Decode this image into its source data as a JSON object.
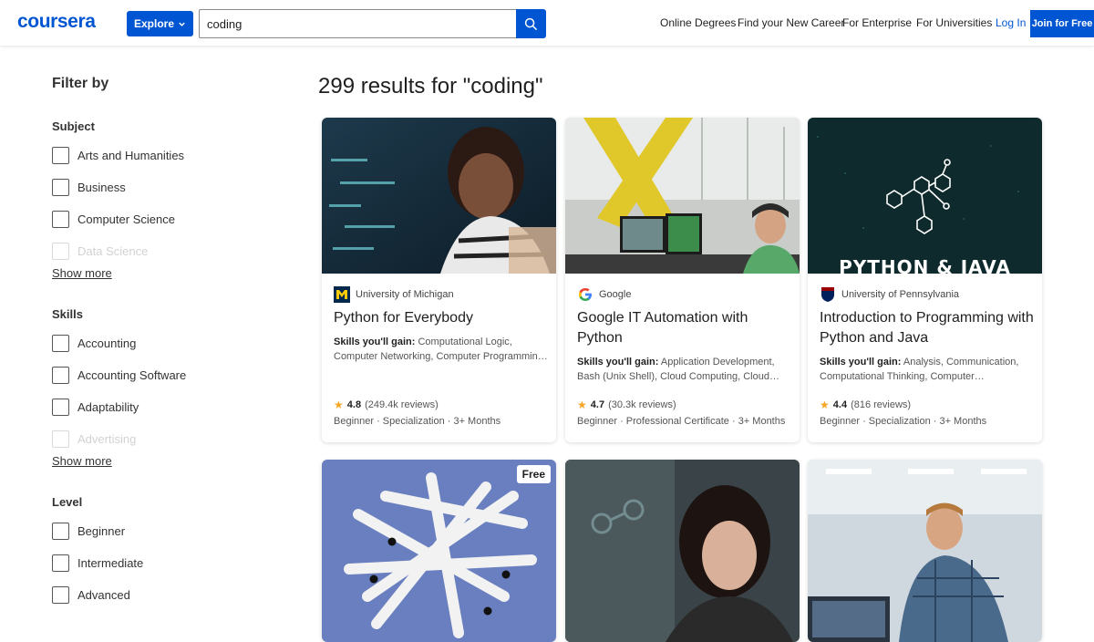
{
  "header": {
    "logo": "coursera",
    "explore_label": "Explore",
    "search_value": "coding",
    "nav": [
      "Online Degrees",
      "Find your New Career",
      "For Enterprise",
      "For Universities"
    ],
    "login": "Log In",
    "join": "Join for Free"
  },
  "sidebar": {
    "title": "Filter by",
    "show_more": "Show more",
    "subject": {
      "title": "Subject",
      "options": [
        "Arts and Humanities",
        "Business",
        "Computer Science",
        "Data Science"
      ]
    },
    "skills": {
      "title": "Skills",
      "options": [
        "Accounting",
        "Accounting Software",
        "Adaptability",
        "Advertising"
      ]
    },
    "level": {
      "title": "Level",
      "options": [
        "Beginner",
        "Intermediate",
        "Advanced"
      ]
    }
  },
  "results": {
    "heading": "299 results for \"coding\"",
    "skills_prefix": "Skills you'll gain:",
    "cards": [
      {
        "partner": "University of Michigan",
        "partner_icon": "michigan-m-logo",
        "title": "Python for Everybody",
        "skills": "Computational Logic, Computer Networking, Computer Programming, Data Structures",
        "rating": "4.8",
        "reviews": "(249.4k reviews)",
        "meta": "Beginner · Specialization · 3+ Months"
      },
      {
        "partner": "Google",
        "partner_icon": "google-g-logo",
        "title": "Google IT Automation with Python",
        "skills": "Application Development, Bash (Unix Shell), Cloud Computing, Cloud Platforms, Computer Programming",
        "rating": "4.7",
        "reviews": "(30.3k reviews)",
        "meta": "Beginner · Professional Certificate · 3+ Months"
      },
      {
        "partner": "University of Pennsylvania",
        "partner_icon": "penn-shield-logo",
        "title": "Introduction to Programming with Python and Java",
        "skills": "Analysis, Communication, Computational Thinking, Computer Programming",
        "rating": "4.4",
        "reviews": "(816 reviews)",
        "meta": "Beginner · Specialization · 3+ Months",
        "image_text": "PYTHON & JAVA"
      }
    ],
    "free_badge": "Free"
  },
  "colors": {
    "brand_blue": "#0056d2",
    "star": "#f5a623"
  }
}
